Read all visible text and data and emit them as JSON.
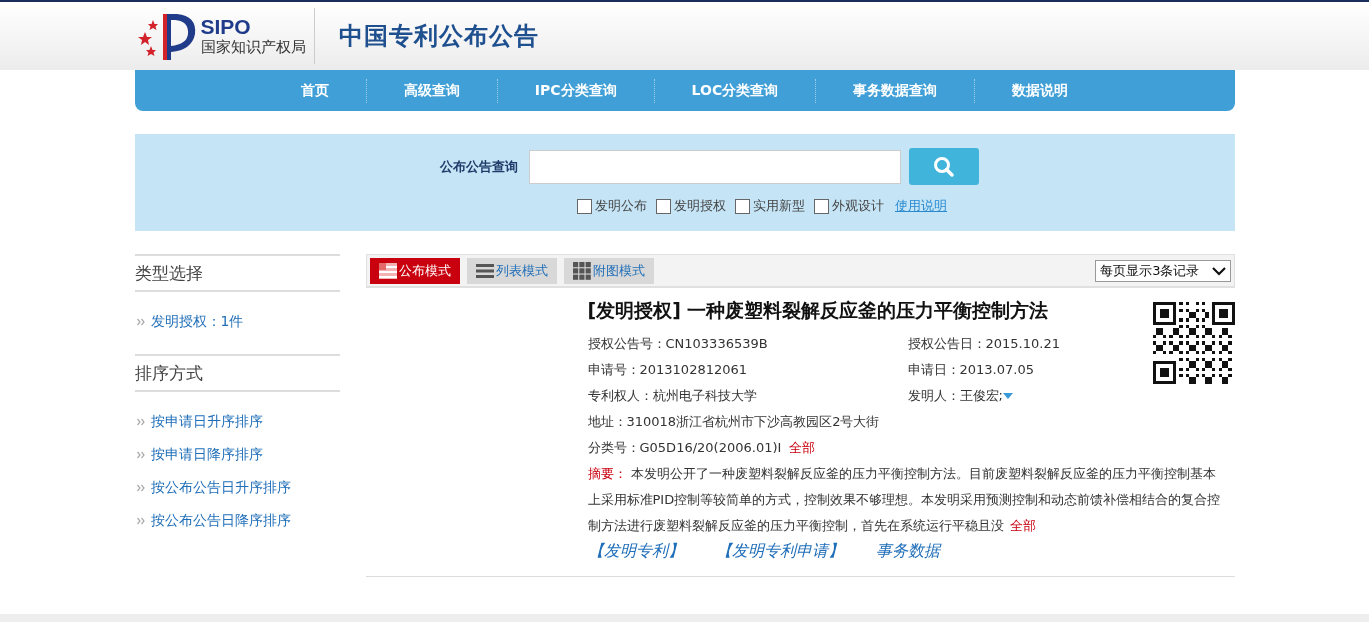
{
  "header": {
    "logo_abbr": "SIPO",
    "logo_name": "国家知识产权局",
    "site_title": "中国专利公布公告"
  },
  "nav": [
    "首页",
    "高级查询",
    "IPC分类查询",
    "LOC分类查询",
    "事务数据查询",
    "数据说明"
  ],
  "search": {
    "label": "公布公告查询",
    "filters": [
      {
        "label": "发明公布",
        "checked": false
      },
      {
        "label": "发明授权",
        "checked": false
      },
      {
        "label": "实用新型",
        "checked": false
      },
      {
        "label": "外观设计",
        "checked": false
      }
    ],
    "help_link": "使用说明"
  },
  "sidebar": {
    "sections": [
      {
        "title": "类型选择",
        "items": [
          "发明授权：1件"
        ]
      },
      {
        "title": "排序方式",
        "items": [
          "按申请日升序排序",
          "按申请日降序排序",
          "按公布公告日升序排序",
          "按公布公告日降序排序"
        ]
      }
    ]
  },
  "view_modes": [
    {
      "label": "公布模式",
      "kind": "flag",
      "selected": true
    },
    {
      "label": "列表模式",
      "kind": "list",
      "selected": false
    },
    {
      "label": "附图模式",
      "kind": "grid",
      "selected": false
    }
  ],
  "page_size": "每页显示3条记录",
  "result": {
    "title": "[发明授权] 一种废塑料裂解反应釜的压力平衡控制方法",
    "fields": [
      {
        "left": "授权公告号：CN103336539B",
        "right": "授权公告日：2015.10.21"
      },
      {
        "left": "申请号：2013102812061",
        "right": "申请日：2013.07.05"
      },
      {
        "left": "专利权人：杭州电子科技大学",
        "right": "发明人：王俊宏;",
        "right_dropdown": true
      }
    ],
    "address": "地址：310018浙江省杭州市下沙高教园区2号大街",
    "classification": "分类号：G05D16/20(2006.01)I",
    "classification_more": "全部",
    "abstract_label": "摘要：",
    "abstract": "本发明公开了一种废塑料裂解反应釜的压力平衡控制方法。目前废塑料裂解反应釜的压力平衡控制基本上采用标准PID控制等较简单的方式，控制效果不够理想。本发明采用预测控制和动态前馈补偿相结合的复合控制方法进行废塑料裂解反应釜的压力平衡控制，首先在系统运行平稳且没",
    "abstract_more": "全部",
    "links": [
      "【发明专利】",
      "【发明专利申请】",
      "事务数据"
    ]
  }
}
